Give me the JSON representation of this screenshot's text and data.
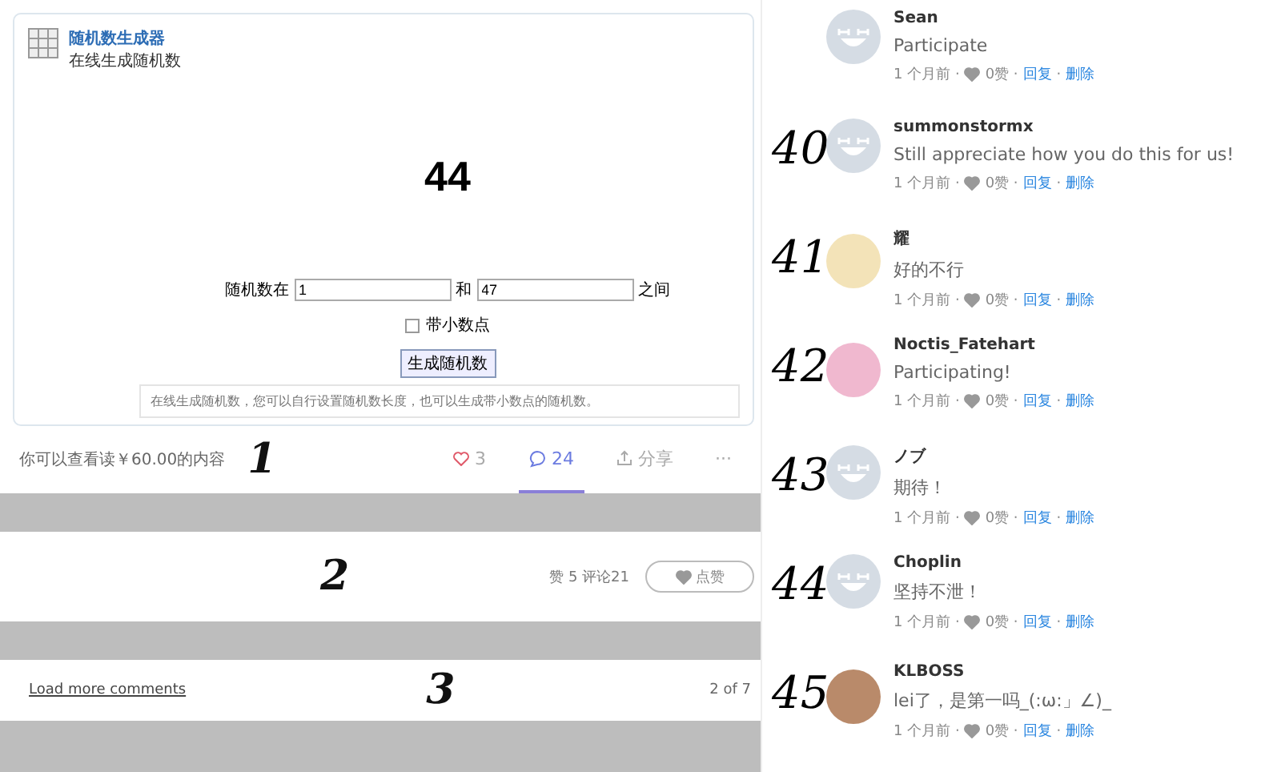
{
  "generator": {
    "title": "随机数生成器",
    "subtitle": "在线生成随机数",
    "result": "44",
    "range_label": "随机数在",
    "from_value": "1",
    "and_label": "和",
    "to_value": "47",
    "between_label": "之间",
    "decimal": {
      "label": "带小数点",
      "checked": false
    },
    "button": "生成随机数",
    "note": "在线生成随机数，您可以自行设置随机数长度，也可以生成带小数点的随机数。"
  },
  "post_bar": {
    "paid_note": "你可以查看读￥60.00的内容",
    "mark": "1",
    "likes": "3",
    "comments": {
      "count": "24",
      "selected": true
    },
    "share": "分享",
    "more": "···"
  },
  "answer_bar": {
    "mark": "2",
    "stats": "赞 5  评论21",
    "like_button": "点赞"
  },
  "load_bar": {
    "link": "Load more comments",
    "mark": "3",
    "pages": "2 of 7"
  },
  "comments": [
    {
      "name": "Sean",
      "avatar_photo": false,
      "text": "Participate",
      "time": "1 个月前 ·",
      "likes": "0赞 ·",
      "reply": "回复",
      "separator": "·",
      "delete": "删除"
    },
    {
      "mark": "40",
      "name": "summonstormx",
      "avatar_photo": false,
      "text": "Still appreciate how you do this for us!",
      "time": "1 个月前 ·",
      "likes": "0赞 ·",
      "reply": "回复",
      "separator": "·",
      "delete": "删除"
    },
    {
      "mark": "41",
      "name": "耀",
      "avatar_photo": true,
      "color": "#f3e3b8",
      "text": "好的不行",
      "time": "1 个月前 ·",
      "likes": "0赞 ·",
      "reply": "回复",
      "separator": "·",
      "delete": "删除"
    },
    {
      "mark": "42",
      "name": "Noctis_Fatehart",
      "avatar_photo": true,
      "color": "#f0b8cf",
      "text": "Participating!",
      "time": "1 个月前 ·",
      "likes": "0赞 ·",
      "reply": "回复",
      "separator": "·",
      "delete": "删除"
    },
    {
      "mark": "43",
      "name": "ノブ",
      "avatar_photo": false,
      "text": "期待！",
      "time": "1 个月前 ·",
      "likes": "0赞 ·",
      "reply": "回复",
      "separator": "·",
      "delete": "删除"
    },
    {
      "mark": "44",
      "name": "Choplin",
      "avatar_photo": false,
      "text": "坚持不泄！",
      "time": "1 个月前 ·",
      "likes": "0赞 ·",
      "reply": "回复",
      "separator": "·",
      "delete": "删除"
    },
    {
      "mark": "45",
      "name": "KLBOSS",
      "avatar_photo": true,
      "color": "#b98a6a",
      "text": "lei了，是第一吗_(:ω:」∠)_",
      "time": "1 个月前 ·",
      "likes": "0赞 ·",
      "reply": "回复",
      "separator": "·",
      "delete": "删除"
    }
  ]
}
